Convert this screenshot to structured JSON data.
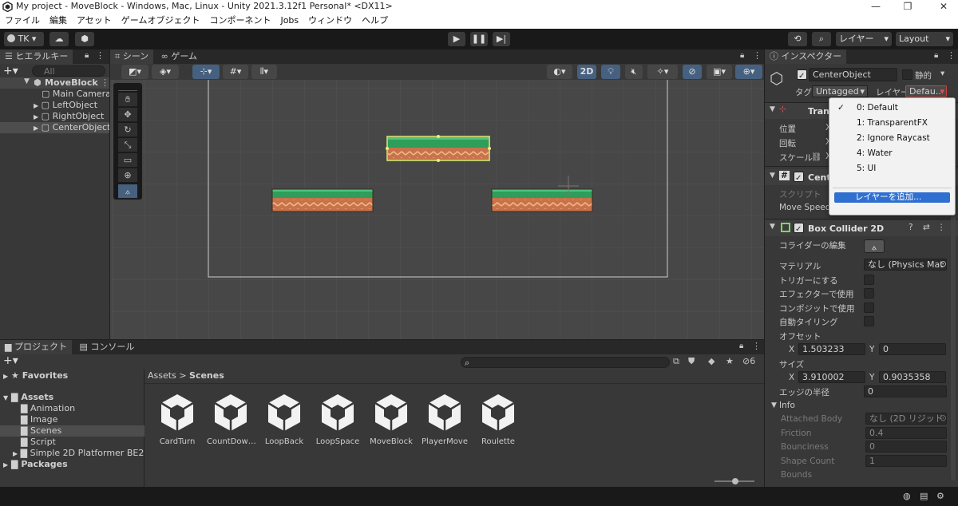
{
  "window": {
    "title": "My project - MoveBlock - Windows, Mac, Linux - Unity 2021.3.12f1 Personal* <DX11>",
    "minimize": "—",
    "maximize": "❐",
    "close": "✕"
  },
  "menu": [
    "ファイル",
    "編集",
    "アセット",
    "ゲームオブジェクト",
    "コンポーネント",
    "Jobs",
    "ウィンドウ",
    "ヘルプ"
  ],
  "toolbar": {
    "account": "TK",
    "layers": "レイヤー",
    "layout": "Layout"
  },
  "hierarchy": {
    "tab": "ヒエラルキー",
    "search_placeholder": "All",
    "scene": "MoveBlock",
    "items": [
      "Main Camera",
      "LeftObject",
      "RightObject",
      "CenterObject"
    ]
  },
  "scene_view": {
    "tab_scene": "シーン",
    "tab_game": "ゲーム",
    "mode_2d": "2D"
  },
  "project": {
    "tab_project": "プロジェクト",
    "tab_console": "コンソール",
    "favorites": "Favorites",
    "assets": "Assets",
    "folders": [
      "Animation",
      "Image",
      "Scenes",
      "Script",
      "Simple 2D Platformer BE2"
    ],
    "packages": "Packages",
    "breadcrumb_root": "Assets",
    "breadcrumb_sep": ">",
    "breadcrumb_current": "Scenes",
    "hidden_count": "6",
    "scenes": [
      "CardTurn",
      "CountDow…",
      "LoopBack",
      "LoopSpace",
      "MoveBlock",
      "PlayerMove",
      "Roulette"
    ]
  },
  "inspector": {
    "tab": "インスペクター",
    "object_name": "CenterObject",
    "static_label": "静的",
    "tag_label": "タグ",
    "tag_value": "Untagged",
    "layer_label": "レイヤー",
    "layer_value": "Defau..",
    "transform": {
      "title": "Tran",
      "position": "位置",
      "rotation": "回転",
      "scale": "スケール",
      "x": "X"
    },
    "script_comp": {
      "title": "Cente",
      "script_label": "スクリプト",
      "move_speed": "Move Speed"
    },
    "box_collider": {
      "title": "Box Collider 2D",
      "edit_collider": "コライダーの編集",
      "material_label": "マテリアル",
      "material_value": "なし (Physics Mat",
      "is_trigger": "トリガーにする",
      "used_by_effector": "エフェクターで使用",
      "used_by_composite": "コンポジットで使用",
      "auto_tiling": "自動タイリング",
      "offset_label": "オフセット",
      "offset_x": "1.503233",
      "offset_y": "0",
      "size_label": "サイズ",
      "size_x": "3.910002",
      "size_y": "0.9035358",
      "edge_radius_label": "エッジの半径",
      "edge_radius": "0",
      "x_label": "X",
      "y_label": "Y"
    },
    "info": {
      "title": "Info",
      "attached_body": "Attached Body",
      "attached_value": "なし (2D リジッド",
      "friction": "Friction",
      "friction_value": "0.4",
      "bounciness": "Bounciness",
      "bounciness_value": "0",
      "shape_count": "Shape Count",
      "shape_count_value": "1",
      "bounds": "Bounds"
    }
  },
  "layer_dropdown": {
    "options": [
      "0: Default",
      "1: TransparentFX",
      "2: Ignore Raycast",
      "4: Water",
      "5: UI"
    ],
    "selected_index": 0,
    "add_layer": "レイヤーを追加..."
  },
  "colors": {
    "accent": "#4d78cc",
    "selection_outline": "#e8f07a",
    "grass": "#2e9e5a",
    "dirt": "#c8734a"
  }
}
